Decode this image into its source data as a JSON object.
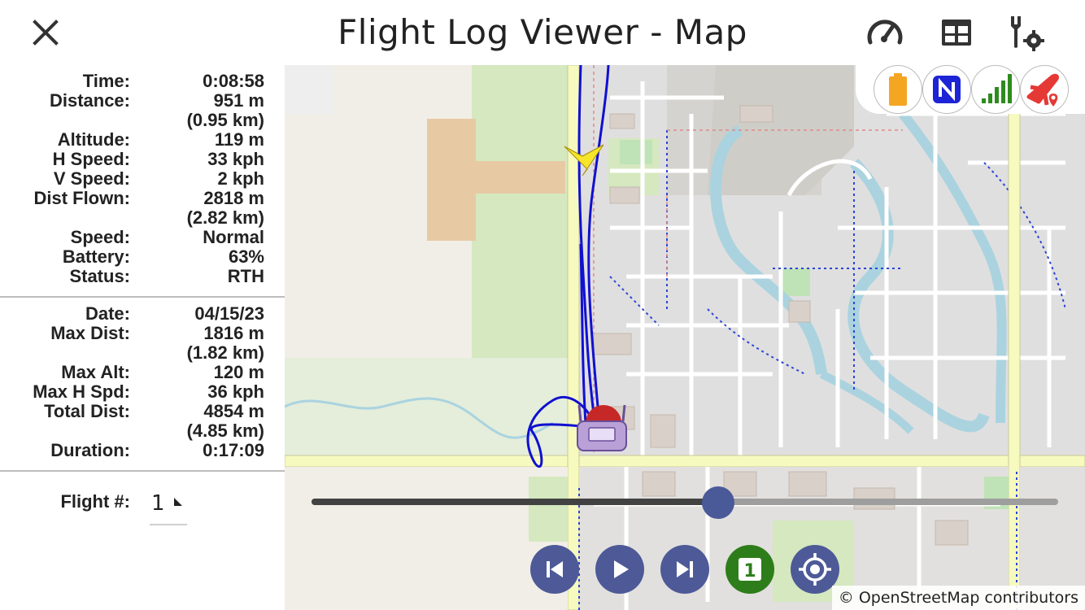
{
  "app": {
    "title": "Flight Log Viewer - Map"
  },
  "toolbar": {
    "close_icon": "close-icon",
    "icons": [
      "speedometer-icon",
      "table-icon",
      "settings-tools-icon"
    ]
  },
  "current": [
    {
      "label": "Time:",
      "value": "0:08:58"
    },
    {
      "label": "Distance:",
      "value": "951 m"
    },
    {
      "label": "",
      "value": "(0.95 km)"
    },
    {
      "label": "Altitude:",
      "value": "119 m"
    },
    {
      "label": "H Speed:",
      "value": "33 kph"
    },
    {
      "label": "V Speed:",
      "value": "2 kph"
    },
    {
      "label": "Dist Flown:",
      "value": "2818 m"
    },
    {
      "label": "",
      "value": "(2.82 km)"
    },
    {
      "label": "Speed:",
      "value": "Normal"
    },
    {
      "label": "Battery:",
      "value": "63%"
    },
    {
      "label": "Status:",
      "value": "RTH"
    }
  ],
  "summary": [
    {
      "label": "Date:",
      "value": "04/15/23"
    },
    {
      "label": "Max Dist:",
      "value": "1816 m"
    },
    {
      "label": "",
      "value": "(1.82 km)"
    },
    {
      "label": "Max Alt:",
      "value": "120 m"
    },
    {
      "label": "Max H Spd:",
      "value": "36 kph"
    },
    {
      "label": "Total Dist:",
      "value": "4854 m"
    },
    {
      "label": "",
      "value": "(4.85 km)"
    },
    {
      "label": "Duration:",
      "value": "0:17:09"
    }
  ],
  "flight": {
    "label": "Flight #:",
    "value": "1"
  },
  "map": {
    "status_icons": [
      "battery-icon",
      "nav-mode-icon",
      "signal-icon",
      "aircraft-location-icon"
    ],
    "playback_progress": 0.545,
    "controls": [
      "skip-previous-icon",
      "play-icon",
      "skip-next-icon",
      "flight-one-icon",
      "recenter-icon"
    ],
    "flight_badge": "1",
    "attribution": "© OpenStreetMap contributors"
  },
  "colors": {
    "track": "#1010d0",
    "control_bg": "#4d5a97",
    "flight_badge_bg": "#2e7d1b",
    "battery": "#f4a623",
    "signal": "#2e8b1e",
    "aircraft": "#e53935"
  }
}
